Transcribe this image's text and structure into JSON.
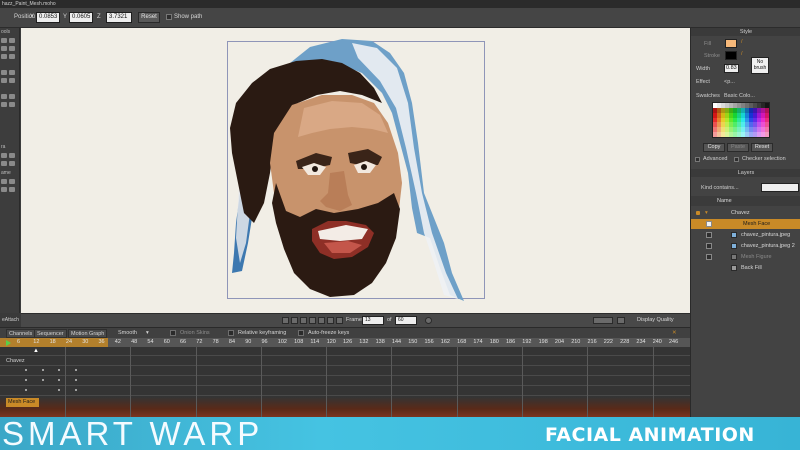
{
  "window": {
    "title": "hazz_Paint_Mesh.moho"
  },
  "tool_options": {
    "position_label": "Position",
    "x_label": "X",
    "x_value": "0.0853",
    "y_label": "Y",
    "y_value": "0.0605",
    "z_label": "Z",
    "z_value": "3.7321",
    "reset_label": "Reset",
    "show_path_label": "Show path"
  },
  "left_tools": {
    "sections": [
      "ools",
      "ra",
      "ame"
    ]
  },
  "playback": {
    "panel_label": "eAttach",
    "frame_label": "Frame",
    "frame_value": "13",
    "of_label": "of",
    "total_frames": "60",
    "display_quality_label": "Display Quality"
  },
  "timeline": {
    "tabs": [
      "Channels",
      "Sequencer",
      "Motion Graph"
    ],
    "interpolation": "Smooth",
    "onion_skins_label": "Onion Skins",
    "relative_keyframing_label": "Relative keyframing",
    "auto_freeze_keys_label": "Auto-freeze keys",
    "ruler_ticks": [
      "0",
      "6",
      "12",
      "18",
      "24",
      "30",
      "36",
      "42",
      "48",
      "54",
      "60",
      "66",
      "72",
      "78",
      "84",
      "90",
      "96",
      "102",
      "108",
      "114",
      "120",
      "126",
      "132",
      "138",
      "144",
      "150",
      "156",
      "162",
      "168",
      "174",
      "180",
      "186",
      "192",
      "198",
      "204",
      "210",
      "216",
      "222",
      "228",
      "234",
      "240",
      "246"
    ],
    "track_names": [
      "Chavez",
      "Mesh Face"
    ]
  },
  "style_panel": {
    "title": "Style",
    "fill_label": "Fill",
    "stroke_label": "Stroke",
    "width_label": "Width",
    "width_value": "0.83",
    "no_brush_label": "No brush",
    "effect_label": "Effect",
    "effect_value": "<p...",
    "swatches_label": "Swatches",
    "swatches_value": "Basic Colo...",
    "copy_label": "Copy",
    "paste_label": "Paste",
    "reset_label": "Reset",
    "advanced_label": "Advanced",
    "checker_label": "Checker selection",
    "fill_color": "#f7b97a",
    "stroke_color": "#000000"
  },
  "layers_panel": {
    "title": "Layers",
    "kind_label": "Kind contains...",
    "name_header": "Name",
    "layers": [
      {
        "name": "Chavez"
      },
      {
        "name": "Mesh Face"
      },
      {
        "name": "chavez_pintura.jpeg"
      },
      {
        "name": "chavez_pintura.jpeg 2"
      },
      {
        "name": "Mesh Figure"
      },
      {
        "name": "Back Fill"
      }
    ]
  },
  "banner": {
    "title": "SMART WARP",
    "subtitle": "FACIAL ANIMATION"
  },
  "colors": {
    "accent_orange": "#c98a27",
    "banner_cyan": "#3fb8d8"
  }
}
